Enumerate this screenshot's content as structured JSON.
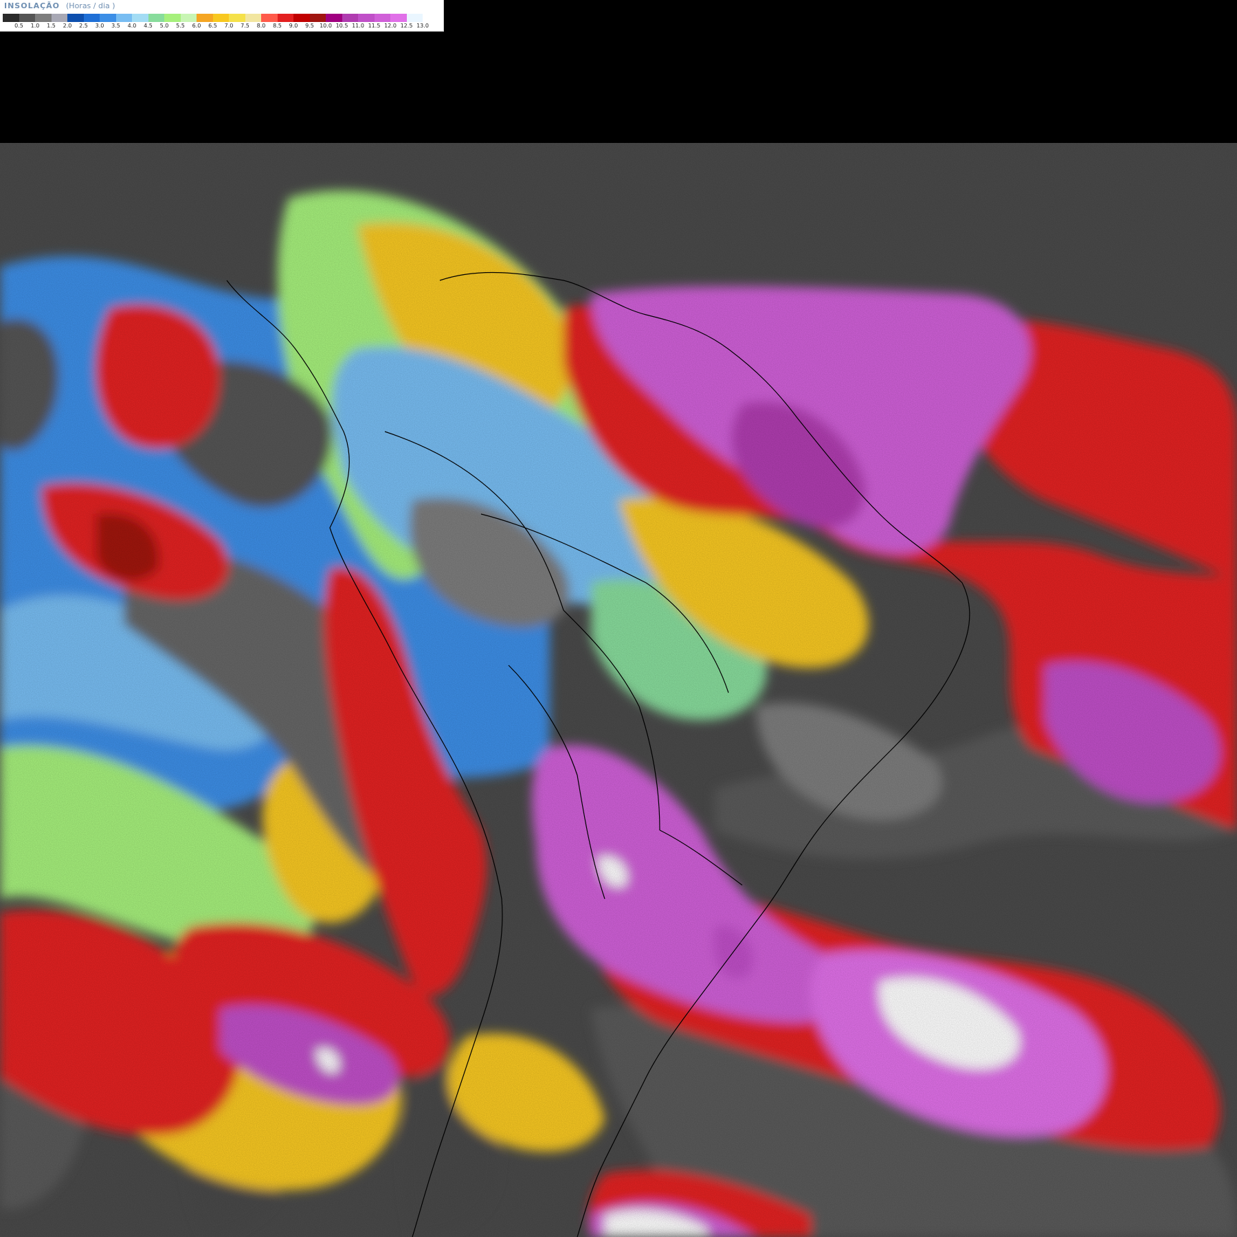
{
  "legend": {
    "title": "INSOLAÇÃO",
    "units": "(Horas / dia )",
    "swatch_colors": [
      "#2b2b2b",
      "#555555",
      "#7d7d7d",
      "#a8a8b4",
      "#0d4fae",
      "#1f6fd6",
      "#3c8ee6",
      "#78bdf2",
      "#a3dcf4",
      "#88dc9c",
      "#a6f07c",
      "#c8f5b4",
      "#f5a623",
      "#f8c820",
      "#f5e14a",
      "#f2e6a0",
      "#ff5a4a",
      "#e32020",
      "#c10000",
      "#a01510",
      "#a00080",
      "#b03cb0",
      "#c050c8",
      "#d060d8",
      "#e070e8",
      "#eaf6ff",
      "#ffffff"
    ],
    "tick_labels": [
      "0.5",
      "1.0",
      "1.5",
      "2.0",
      "2.5",
      "3.0",
      "3.5",
      "4.0",
      "4.5",
      "5.0",
      "5.5",
      "6.0",
      "6.5",
      "7.0",
      "7.5",
      "8.0",
      "8.5",
      "9.0",
      "9.5",
      "10.0",
      "10.5",
      "11.0",
      "11.5",
      "12.0",
      "12.5",
      "13.0"
    ]
  }
}
